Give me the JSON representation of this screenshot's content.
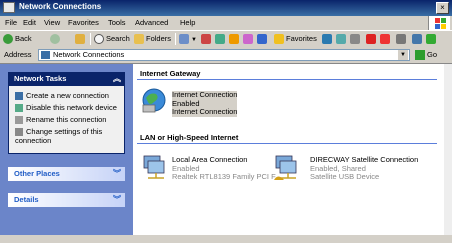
{
  "window": {
    "title": "Network Connections",
    "close_label": "×"
  },
  "menu": [
    "File",
    "Edit",
    "View",
    "Favorites",
    "Tools",
    "Advanced",
    "Help"
  ],
  "toolbar": {
    "back": "Back",
    "search": "Search",
    "folders": "Folders",
    "favorites": "Favorites"
  },
  "address": {
    "label": "Address",
    "value": "Network Connections",
    "go": "Go"
  },
  "sidebar": {
    "network_tasks": {
      "title": "Network Tasks",
      "items": [
        "Create a new connection",
        "Disable this network device",
        "Rename this connection",
        "Change settings of this connection"
      ]
    },
    "other_places": "Other Places",
    "details": "Details"
  },
  "groups": {
    "gateway": {
      "title": "Internet Gateway",
      "item": {
        "name": "Internet Connection",
        "status": "Enabled",
        "device": "Internet Connection"
      }
    },
    "lan": {
      "title": "LAN or High-Speed Internet",
      "items": [
        {
          "name": "Local Area Connection",
          "status": "Enabled",
          "device": "Realtek RTL8139 Family PCI F..."
        },
        {
          "name": "DIRECWAY Satellite Connection",
          "status": "Enabled, Shared",
          "device": "Satellite USB Device"
        }
      ]
    }
  },
  "colors": {
    "title_bar": "#0a246a",
    "sidebar_bg": "#6b85c9",
    "accent": "#215dc6"
  }
}
